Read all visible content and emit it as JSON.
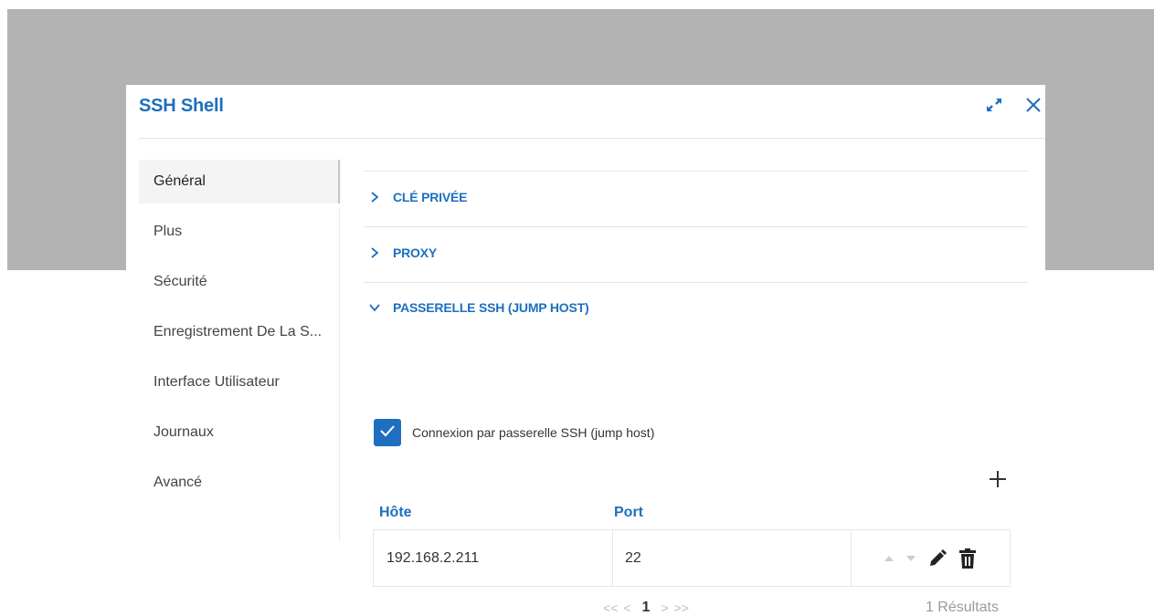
{
  "dialog": {
    "title": "SSH Shell",
    "expand_icon": "expand-icon",
    "close_icon": "close-icon"
  },
  "sidebar": {
    "items": [
      {
        "label": "Général",
        "active": true
      },
      {
        "label": "Plus"
      },
      {
        "label": "Sécurité"
      },
      {
        "label": "Enregistrement De La S..."
      },
      {
        "label": "Interface Utilisateur"
      },
      {
        "label": "Journaux"
      },
      {
        "label": "Avancé"
      }
    ]
  },
  "sections": [
    {
      "label": "CLÉ PRIVÉE",
      "expanded": false
    },
    {
      "label": "PROXY",
      "expanded": false
    },
    {
      "label": "PASSERELLE SSH (JUMP HOST)",
      "expanded": true
    }
  ],
  "jump_host": {
    "checkbox_label": "Connexion par passerelle SSH (jump host)",
    "checked": true,
    "add_icon": "plus-icon",
    "columns": [
      "Hôte",
      "Port"
    ],
    "rows": [
      {
        "host": "192.168.2.211",
        "port": "22"
      }
    ],
    "row_actions": [
      "move-up-icon",
      "move-down-icon",
      "edit-icon",
      "delete-icon"
    ]
  },
  "pagination": {
    "first": "<<",
    "prev": "<",
    "current": "1",
    "next": ">",
    "last": ">>",
    "results": "1 Résultats"
  },
  "colors": {
    "accent": "#1e6fc0",
    "backdrop": "#b3b3b3",
    "active_item_bg": "#f4f4f4",
    "divider": "#dbe6f1"
  }
}
